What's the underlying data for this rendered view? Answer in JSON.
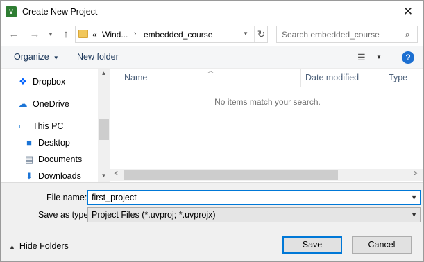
{
  "window": {
    "title": "Create New Project",
    "app_icon_text": "V",
    "close_glyph": "✕"
  },
  "address": {
    "overflow": "«",
    "crumbs": [
      "Wind...",
      "embedded_course"
    ],
    "refresh_glyph": "↻"
  },
  "search": {
    "placeholder": "Search embedded_course"
  },
  "toolbar": {
    "organize_label": "Organize",
    "new_folder_label": "New folder",
    "help_glyph": "?"
  },
  "nav": {
    "items": [
      {
        "label": "Dropbox",
        "icon": "dropbox-icon"
      },
      {
        "label": "OneDrive",
        "icon": "onedrive-icon"
      },
      {
        "label": "This PC",
        "icon": "this-pc-icon"
      },
      {
        "label": "Desktop",
        "icon": "desktop-icon"
      },
      {
        "label": "Documents",
        "icon": "documents-icon"
      },
      {
        "label": "Downloads",
        "icon": "downloads-icon"
      }
    ]
  },
  "filelist": {
    "columns": [
      "Name",
      "Date modified",
      "Type"
    ],
    "empty_message": "No items match your search."
  },
  "form": {
    "filename_label": "File name:",
    "filename_value": "first_project",
    "savetype_label": "Save as type:",
    "savetype_value": "Project Files (*.uvproj; *.uvprojx)",
    "hide_folders_label": "Hide Folders",
    "save_label": "Save",
    "cancel_label": "Cancel"
  },
  "colors": {
    "accent": "#0078d7",
    "toolbar_text": "#1e395b",
    "help_blue": "#1c6fd1"
  }
}
